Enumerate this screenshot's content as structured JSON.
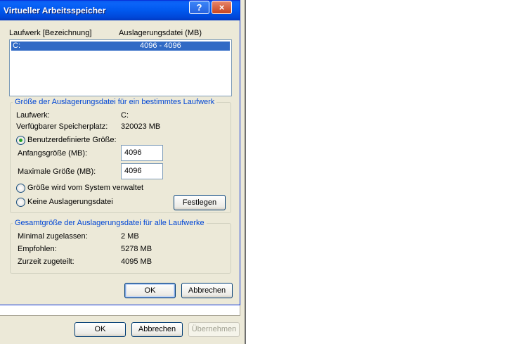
{
  "window": {
    "title": "Virtueller Arbeitsspeicher",
    "help_glyph": "?",
    "close_glyph": "×"
  },
  "list": {
    "col_drive": "Laufwerk [Bezeichnung]",
    "col_paging": "Auslagerungsdatei (MB)",
    "rows": [
      {
        "drive": "C:",
        "size": "4096 - 4096"
      }
    ]
  },
  "drive_group": {
    "title": "Größe der Auslagerungsdatei für ein bestimmtes Laufwerk",
    "drive_label": "Laufwerk:",
    "drive_value": "C:",
    "space_label": "Verfügbarer Speicherplatz:",
    "space_value": "320023 MB",
    "radio_custom": "Benutzerdefinierte Größe:",
    "initial_label": "Anfangsgröße (MB):",
    "initial_value": "4096",
    "max_label": "Maximale Größe (MB):",
    "max_value": "4096",
    "radio_system": "Größe wird vom System verwaltet",
    "radio_none": "Keine Auslagerungsdatei",
    "set_button": "Festlegen",
    "selected_option": "custom"
  },
  "total_group": {
    "title": "Gesamtgröße der Auslagerungsdatei für alle Laufwerke",
    "min_label": "Minimal zugelassen:",
    "min_value": "2 MB",
    "rec_label": "Empfohlen:",
    "rec_value": "5278 MB",
    "cur_label": "Zurzeit zugeteilt:",
    "cur_value": "4095 MB"
  },
  "dialog_buttons": {
    "ok": "OK",
    "cancel": "Abbrechen"
  },
  "parent_buttons": {
    "ok": "OK",
    "cancel": "Abbrechen",
    "apply": "Übernehmen"
  },
  "colors": {
    "titlebar": "#0058ee",
    "selection": "#316ac5",
    "group_title": "#0046d5",
    "dialog_bg": "#ece9d8"
  }
}
